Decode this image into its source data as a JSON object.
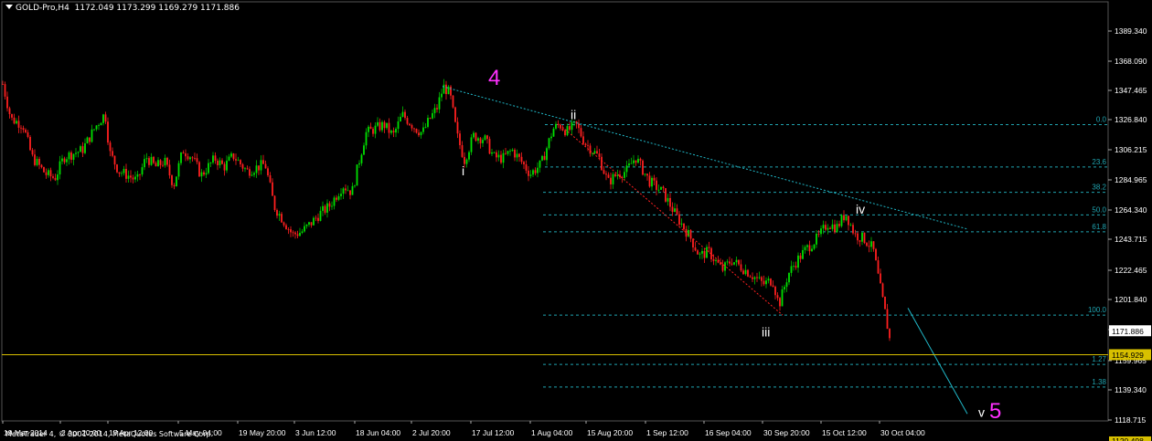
{
  "header": {
    "symbol": "GOLD-Pro,H4",
    "ohlc": "1172.049 1173.299 1169.279 1171.886"
  },
  "footer": {
    "copyright": "MetaTrader 4, © 2001-2014, MetaQuotes Software Corp."
  },
  "colors": {
    "background": "#000000",
    "bull": "#00e000",
    "bear": "#ff2020",
    "grid": "#2b2b2b",
    "trendline": "#20b8c8",
    "fib": "#20a4b0",
    "wave_big": "#ff30ff",
    "wave_small": "#ffffff",
    "price_line": "#d8c000",
    "wick": "#00c000"
  },
  "price_axis": {
    "ticks": [
      "1389.340",
      "1368.090",
      "1347.465",
      "1326.840",
      "1306.215",
      "1284.965",
      "1264.340",
      "1243.715",
      "1222.465",
      "1201.840",
      "1181.215",
      "1159.965",
      "1139.340",
      "1118.715"
    ],
    "current_price": "1171.886",
    "marker_price": "1154.929",
    "bottom_marker": "1120.498"
  },
  "time_axis": {
    "labels": [
      "19 Mar 2014",
      "2 Apr 20:00",
      "17 Apr 12:00",
      "5 May 04:00",
      "19 May 20:00",
      "3 Jun 12:00",
      "18 Jun 04:00",
      "2 Jul 20:00",
      "17 Jul 12:00",
      "1 Aug 04:00",
      "15 Aug 20:00",
      "1 Sep 12:00",
      "16 Sep 04:00",
      "30 Sep 20:00",
      "15 Oct 12:00",
      "30 Oct 04:00"
    ]
  },
  "fibonacci": {
    "levels": [
      "0.0",
      "23.6",
      "38.2",
      "50.0",
      "61.8",
      "100.0",
      "1.27",
      "1.38"
    ],
    "prices": [
      1318.0,
      1288.0,
      1270.0,
      1254.0,
      1242.0,
      1183.0,
      1148.0,
      1132.0
    ]
  },
  "waves": {
    "w4": "4",
    "w5": "5",
    "i": "i",
    "ii": "ii",
    "iii": "iii",
    "iv": "iv",
    "v": "v"
  },
  "chart_data": {
    "type": "candlestick",
    "title": "GOLD-Pro,H4",
    "ylim": [
      1108,
      1405
    ],
    "current_price": 1171.886,
    "horizontal_line": 1154.929,
    "price_path": [
      [
        0,
        1355
      ],
      [
        12,
        1322
      ],
      [
        25,
        1318
      ],
      [
        35,
        1295
      ],
      [
        50,
        1283
      ],
      [
        60,
        1280
      ],
      [
        70,
        1295
      ],
      [
        90,
        1300
      ],
      [
        105,
        1317
      ],
      [
        115,
        1326
      ],
      [
        120,
        1298
      ],
      [
        130,
        1285
      ],
      [
        140,
        1282
      ],
      [
        150,
        1278
      ],
      [
        160,
        1295
      ],
      [
        170,
        1288
      ],
      [
        180,
        1292
      ],
      [
        190,
        1275
      ],
      [
        200,
        1300
      ],
      [
        210,
        1295
      ],
      [
        220,
        1282
      ],
      [
        235,
        1294
      ],
      [
        245,
        1288
      ],
      [
        255,
        1296
      ],
      [
        270,
        1285
      ],
      [
        290,
        1290
      ],
      [
        300,
        1260
      ],
      [
        310,
        1250
      ],
      [
        320,
        1240
      ],
      [
        330,
        1242
      ],
      [
        340,
        1248
      ],
      [
        350,
        1255
      ],
      [
        360,
        1260
      ],
      [
        375,
        1275
      ],
      [
        385,
        1270
      ],
      [
        392,
        1290
      ],
      [
        400,
        1312
      ],
      [
        410,
        1315
      ],
      [
        420,
        1318
      ],
      [
        430,
        1310
      ],
      [
        440,
        1325
      ],
      [
        455,
        1315
      ],
      [
        462,
        1312
      ],
      [
        470,
        1322
      ],
      [
        478,
        1330
      ],
      [
        485,
        1345
      ],
      [
        492,
        1340
      ],
      [
        500,
        1310
      ],
      [
        508,
        1293
      ],
      [
        518,
        1310
      ],
      [
        530,
        1308
      ],
      [
        540,
        1295
      ],
      [
        550,
        1294
      ],
      [
        560,
        1300
      ],
      [
        570,
        1292
      ],
      [
        580,
        1283
      ],
      [
        592,
        1290
      ],
      [
        605,
        1315
      ],
      [
        612,
        1318
      ],
      [
        620,
        1313
      ],
      [
        630,
        1318
      ],
      [
        640,
        1305
      ],
      [
        655,
        1295
      ],
      [
        665,
        1277
      ],
      [
        675,
        1283
      ],
      [
        685,
        1285
      ],
      [
        695,
        1295
      ],
      [
        710,
        1278
      ],
      [
        725,
        1270
      ],
      [
        740,
        1253
      ],
      [
        755,
        1238
      ],
      [
        765,
        1225
      ],
      [
        775,
        1228
      ],
      [
        790,
        1215
      ],
      [
        800,
        1222
      ],
      [
        815,
        1215
      ],
      [
        825,
        1210
      ],
      [
        835,
        1205
      ],
      [
        845,
        1208
      ],
      [
        852,
        1190
      ],
      [
        862,
        1212
      ],
      [
        872,
        1222
      ],
      [
        882,
        1230
      ],
      [
        895,
        1238
      ],
      [
        905,
        1248
      ],
      [
        915,
        1245
      ],
      [
        925,
        1255
      ],
      [
        935,
        1240
      ],
      [
        945,
        1237
      ],
      [
        955,
        1230
      ],
      [
        962,
        1205
      ],
      [
        968,
        1185
      ],
      [
        973,
        1166
      ]
    ]
  }
}
